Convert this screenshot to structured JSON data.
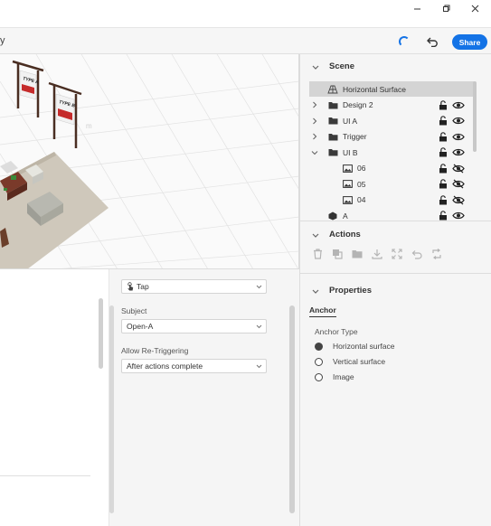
{
  "window": {
    "min_icon": "minimize-icon",
    "max_icon": "restore-icon",
    "close_icon": "close-icon"
  },
  "appbar": {
    "cut_title": "y",
    "share_label": "Share",
    "accent": "#1473e6"
  },
  "scene": {
    "title": "Scene",
    "items": [
      {
        "label": "Horizontal Surface",
        "selected": true,
        "icon": "surface-icon"
      },
      {
        "label": "Design 2",
        "icon": "folder-icon"
      },
      {
        "label": "UI A",
        "icon": "folder-icon"
      },
      {
        "label": "Trigger",
        "icon": "folder-icon"
      },
      {
        "label": "UI B",
        "icon": "folder-icon",
        "expanded": true
      },
      {
        "label": "06",
        "icon": "image-icon",
        "hidden": true
      },
      {
        "label": "05",
        "icon": "image-icon",
        "hidden": true
      },
      {
        "label": "04",
        "icon": "image-icon",
        "hidden": true
      },
      {
        "label": "A",
        "icon": "object-icon"
      }
    ]
  },
  "actions": {
    "title": "Actions",
    "icons": [
      "delete-icon",
      "duplicate-icon",
      "group-icon",
      "download-icon",
      "expand-icon",
      "undo-icon",
      "replace-icon"
    ]
  },
  "properties": {
    "title": "Properties",
    "tab": "Anchor",
    "anchor_type_label": "Anchor Type",
    "options": [
      {
        "label": "Horizontal surface",
        "checked": true
      },
      {
        "label": "Vertical surface",
        "checked": false
      },
      {
        "label": "Image",
        "checked": false
      }
    ]
  },
  "trigger": {
    "trigger_value": "Tap",
    "subject_label": "Subject",
    "subject_value": "Open-A",
    "retrigger_label": "Allow Re-Triggering",
    "retrigger_value": "After actions complete"
  },
  "viewport": {
    "sign_a": "TYPE A",
    "sign_b": "TYPE B",
    "ghost_text": "m"
  }
}
